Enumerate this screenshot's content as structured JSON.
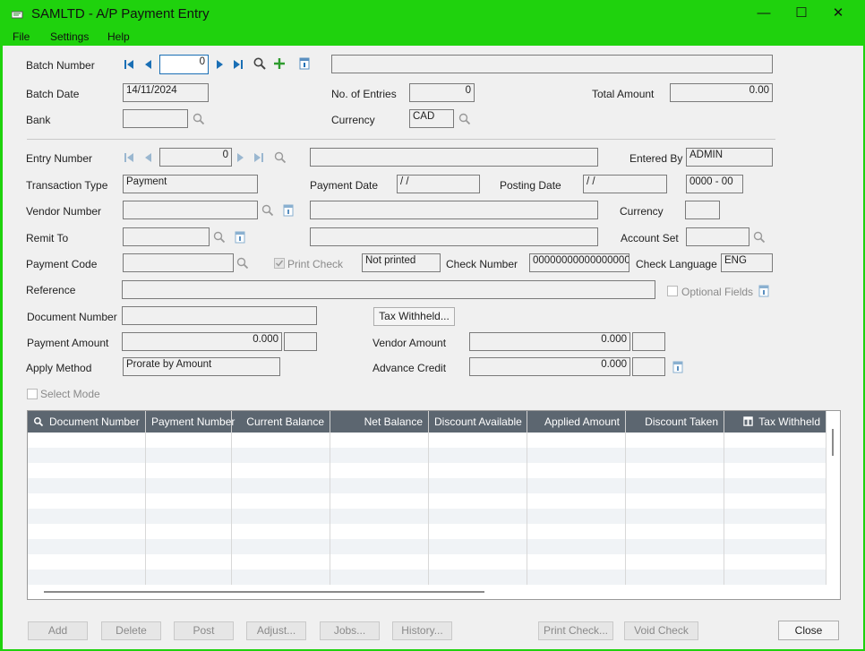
{
  "window": {
    "title": "SAMLTD - A/P Payment Entry",
    "minimize": "—",
    "maximize": "☐",
    "close": "✕"
  },
  "menu": {
    "file": "File",
    "settings": "Settings",
    "help": "Help"
  },
  "batch": {
    "number_label": "Batch Number",
    "number_value": "0",
    "description": "",
    "date_label": "Batch Date",
    "date_value": "14/11/2024",
    "entries_label": "No. of Entries",
    "entries_value": "0",
    "total_label": "Total Amount",
    "total_value": "0.00",
    "bank_label": "Bank",
    "bank_value": "",
    "currency_label": "Currency",
    "currency_value": "CAD"
  },
  "entry": {
    "number_label": "Entry Number",
    "number_value": "0",
    "description": "",
    "entered_by_label": "Entered By",
    "entered_by_value": "ADMIN",
    "trans_type_label": "Transaction Type",
    "trans_type_value": "Payment",
    "payment_date_label": "Payment Date",
    "payment_date_value": " /  /",
    "posting_date_label": "Posting Date",
    "posting_date_value": " /  /",
    "period_value": "0000 - 00",
    "vendor_label": "Vendor Number",
    "vendor_value": "",
    "vendor_name": "",
    "vendor_currency_label": "Currency",
    "vendor_currency_value": "",
    "remit_label": "Remit To",
    "remit_value": "",
    "remit_name": "",
    "account_set_label": "Account Set",
    "account_set_value": "",
    "payment_code_label": "Payment Code",
    "payment_code_value": "",
    "print_check_label": "Print Check",
    "print_status": "Not printed",
    "check_number_label": "Check Number",
    "check_number_value": "000000000000000000",
    "check_language_label": "Check Language",
    "check_language_value": "ENG",
    "reference_label": "Reference",
    "reference_value": "",
    "optional_fields_label": "Optional Fields",
    "doc_number_label": "Document Number",
    "doc_number_value": "",
    "tax_withheld_button": "Tax Withheld...",
    "payment_amount_label": "Payment Amount",
    "payment_amount_value": "0.000",
    "vendor_amount_label": "Vendor Amount",
    "vendor_amount_value": "0.000",
    "apply_method_label": "Apply Method",
    "apply_method_value": "Prorate by Amount",
    "advance_credit_label": "Advance Credit",
    "advance_credit_value": "0.000",
    "select_mode_label": "Select Mode"
  },
  "grid": {
    "columns": [
      "Document Number",
      "Payment Number",
      "Current Balance",
      "Net Balance",
      "Discount Available",
      "Applied Amount",
      "Discount Taken",
      "Tax Withheld"
    ]
  },
  "buttons": {
    "add": "Add",
    "delete": "Delete",
    "post": "Post",
    "adjust": "Adjust...",
    "jobs": "Jobs...",
    "history": "History...",
    "print_check": "Print Check...",
    "void_check": "Void Check",
    "close": "Close"
  },
  "colors": {
    "title_bar": "#1fd20d",
    "grid_header": "#5c6670",
    "nav_blue": "#1a6fb5",
    "add_green": "#2e9b2e"
  }
}
